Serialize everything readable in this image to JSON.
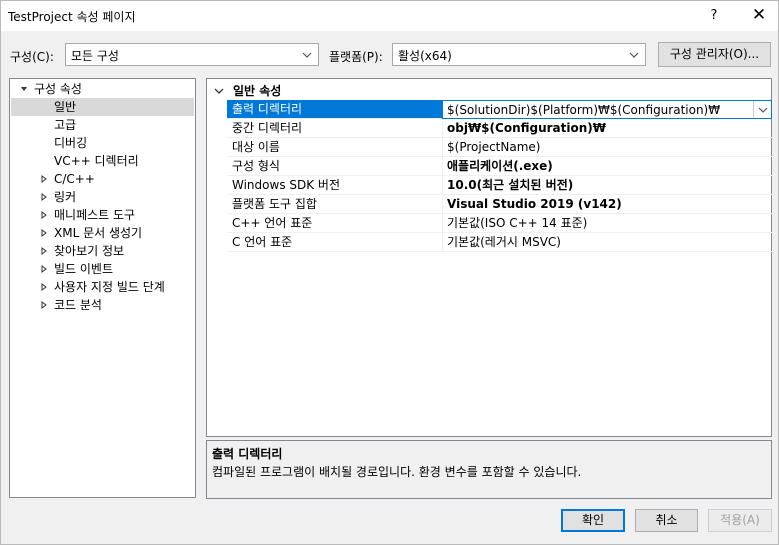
{
  "window": {
    "title": "TestProject 속성 페이지",
    "help_label": "?",
    "close_label": "✕"
  },
  "toolbar": {
    "config_label": "구성(C):",
    "config_value": "모든 구성",
    "platform_label": "플랫폼(P):",
    "platform_value": "활성(x64)",
    "config_manager_label": "구성 관리자(O)..."
  },
  "tree": {
    "root": "구성 속성",
    "children": [
      "일반",
      "고급",
      "디버깅",
      "VC++ 디렉터리"
    ],
    "groups": [
      "C/C++",
      "링커",
      "매니페스트 도구",
      "XML 문서 생성기",
      "찾아보기 정보",
      "빌드 이벤트",
      "사용자 지정 빌드 단계",
      "코드 분석"
    ],
    "selected": "일반"
  },
  "grid": {
    "category": "일반 속성",
    "rows": [
      {
        "name": "출력 디렉터리",
        "value": "$(SolutionDir)$(Platform)₩$(Configuration)₩",
        "bold": false
      },
      {
        "name": "중간 디렉터리",
        "value": "obj₩$(Configuration)₩",
        "bold": true
      },
      {
        "name": "대상 이름",
        "value": "$(ProjectName)",
        "bold": false
      },
      {
        "name": "구성 형식",
        "value": "애플리케이션(.exe)",
        "bold": true
      },
      {
        "name": "Windows SDK 버전",
        "value": "10.0(최근 설치된 버전)",
        "bold": true
      },
      {
        "name": "플랫폼 도구 집합",
        "value": "Visual Studio 2019 (v142)",
        "bold": true
      },
      {
        "name": "C++ 언어 표준",
        "value": "기본값(ISO C++ 14 표준)",
        "bold": false
      },
      {
        "name": "C 언어 표준",
        "value": "기본값(레거시 MSVC)",
        "bold": false
      }
    ]
  },
  "description": {
    "title": "출력 디렉터리",
    "text": "컴파일된 프로그램이 배치될 경로입니다. 환경 변수를 포함할 수 있습니다."
  },
  "buttons": {
    "ok": "확인",
    "cancel": "취소",
    "apply": "적용(A)"
  },
  "colors": {
    "selection": "#0078d7",
    "tree_selection": "#d9d9d9"
  },
  "icons": {
    "expanded": "triangle-down-icon",
    "collapsed": "triangle-right-icon",
    "dropdown": "chevron-down-icon"
  }
}
